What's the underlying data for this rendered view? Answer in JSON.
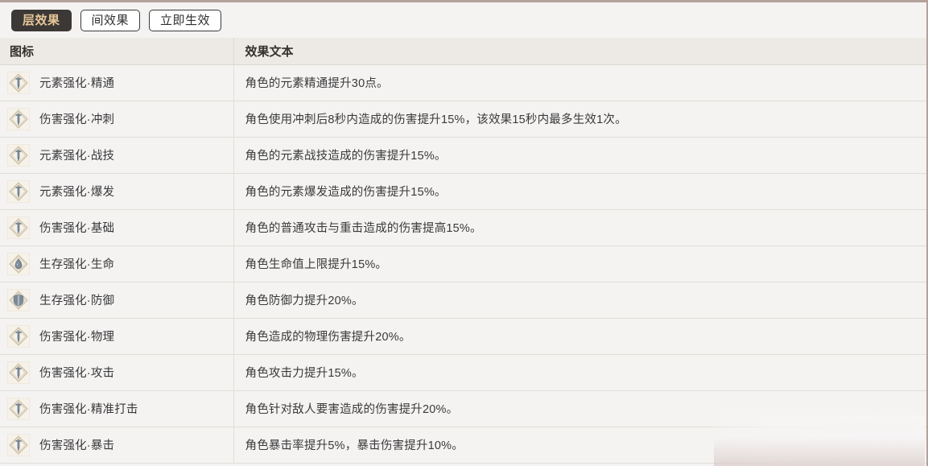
{
  "tabs": [
    {
      "label": "层效果",
      "active": true
    },
    {
      "label": "间效果",
      "active": false
    },
    {
      "label": "立即生效",
      "active": false
    }
  ],
  "table": {
    "headers": {
      "icon": "图标",
      "text": "效果文本"
    },
    "rows": [
      {
        "icon": "sword-icon",
        "name": "元素强化·精通",
        "text": "角色的元素精通提升30点。"
      },
      {
        "icon": "sword-icon",
        "name": "伤害强化·冲刺",
        "text": "角色使用冲刺后8秒内造成的伤害提升15%，该效果15秒内最多生效1次。"
      },
      {
        "icon": "sword-icon",
        "name": "元素强化·战技",
        "text": "角色的元素战技造成的伤害提升15%。"
      },
      {
        "icon": "sword-icon",
        "name": "元素强化·爆发",
        "text": "角色的元素爆发造成的伤害提升15%。"
      },
      {
        "icon": "sword-icon",
        "name": "伤害强化·基础",
        "text": "角色的普通攻击与重击造成的伤害提高15%。"
      },
      {
        "icon": "droplet-icon",
        "name": "生存强化·生命",
        "text": "角色生命值上限提升15%。"
      },
      {
        "icon": "shield-icon",
        "name": "生存强化·防御",
        "text": "角色防御力提升20%。"
      },
      {
        "icon": "sword-icon",
        "name": "伤害强化·物理",
        "text": "角色造成的物理伤害提升20%。"
      },
      {
        "icon": "sword-icon",
        "name": "伤害强化·攻击",
        "text": "角色攻击力提升15%。"
      },
      {
        "icon": "sword-icon",
        "name": "伤害强化·精准打击",
        "text": "角色针对敌人要害造成的伤害提升20%。"
      },
      {
        "icon": "sword-icon",
        "name": "伤害强化·暴击",
        "text": "角色暴击率提升5%，暴击伤害提升10%。"
      }
    ]
  },
  "colors": {
    "page_bg": "#f4f3f2",
    "top_border": "#b5a29c",
    "header_bg": "#edeae5",
    "active_tab_bg": "#3b3836",
    "active_tab_text": "#e7c79a",
    "row_divider": "#e2ddd5",
    "icon_frame": "#cfc2a8",
    "icon_glyph": "#7d8b99"
  }
}
